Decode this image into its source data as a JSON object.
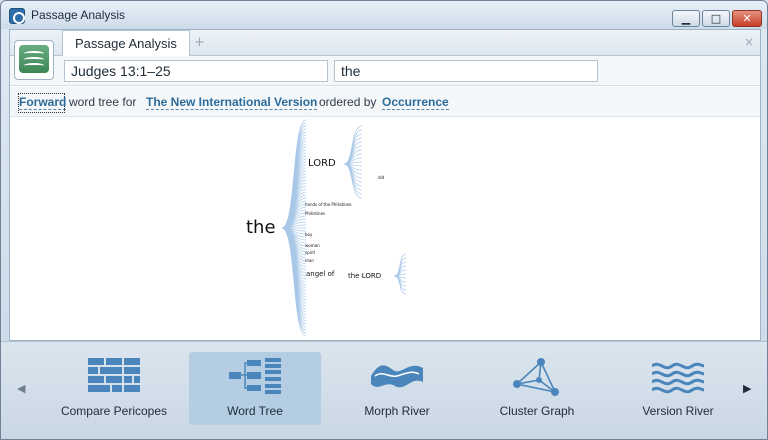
{
  "window": {
    "title": "Passage Analysis",
    "minimize_glyph": "▁",
    "maximize_glyph": "□",
    "close_glyph": "✕"
  },
  "tabs": {
    "active_label": "Passage Analysis",
    "add_glyph": "+",
    "close_glyph": "×"
  },
  "inputs": {
    "reference_value": "Judges 13:1–25",
    "query_value": "the"
  },
  "settings": {
    "direction": "Forward",
    "text1": "word tree for",
    "version": "The New International Version",
    "text2": "ordered by",
    "order": "Occurrence"
  },
  "word_tree": {
    "root": "the",
    "branches": [
      "LORD",
      "the LORD",
      "angel of"
    ],
    "small_labels": [
      "hands of the Philistines",
      "Philistines",
      "boy",
      "woman",
      "spirit",
      "man",
      "did"
    ]
  },
  "tools": {
    "items": [
      {
        "label": "Compare Pericopes",
        "icon": "compare-pericopes-icon"
      },
      {
        "label": "Word Tree",
        "icon": "word-tree-icon",
        "active": true
      },
      {
        "label": "Morph River",
        "icon": "morph-river-icon"
      },
      {
        "label": "Cluster Graph",
        "icon": "cluster-graph-icon"
      },
      {
        "label": "Version River",
        "icon": "version-river-icon"
      }
    ],
    "prev_glyph": "◀",
    "next_glyph": "▶"
  },
  "colors": {
    "accent": "#2d6b99",
    "tree_line": "#a9c8e8",
    "icon_blue": "#4a86bb",
    "active_tool": "#b4cde2"
  }
}
